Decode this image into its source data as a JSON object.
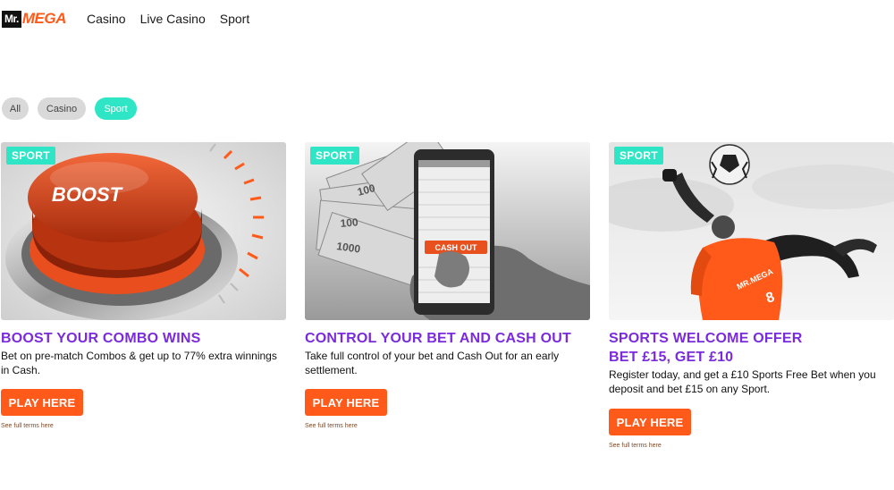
{
  "brand": {
    "mr": "Mr.",
    "mega": "MEGA"
  },
  "nav": {
    "items": [
      "Casino",
      "Live Casino",
      "Sport"
    ]
  },
  "filters": {
    "all": "All",
    "casino": "Casino",
    "sport": "Sport"
  },
  "colors": {
    "accent_orange": "#ff5a1a",
    "accent_teal": "#2ee6c6",
    "title_purple": "#7a2bdc"
  },
  "cards": [
    {
      "badge": "SPORT",
      "title": "BOOST YOUR COMBO WINS",
      "title2": "",
      "desc": "Bet on pre-match Combos & get up to 77% extra winnings in Cash.",
      "button": "PLAY HERE",
      "terms": "See full terms here",
      "image_text": "BOOST"
    },
    {
      "badge": "SPORT",
      "title": "CONTROL YOUR BET AND CASH OUT",
      "title2": "",
      "desc": "Take full control of your bet and Cash Out for an early settlement.",
      "button": "PLAY HERE",
      "terms": "See full terms here",
      "image_text": "CASH OUT"
    },
    {
      "badge": "SPORT",
      "title": "SPORTS WELCOME OFFER",
      "title2": "BET £15, GET £10",
      "desc": "Register today, and get a £10 Sports Free Bet when you deposit and bet £15 on any Sport.",
      "button": "PLAY HERE",
      "terms": "See full terms here",
      "image_text": "MR.MEGA"
    }
  ]
}
